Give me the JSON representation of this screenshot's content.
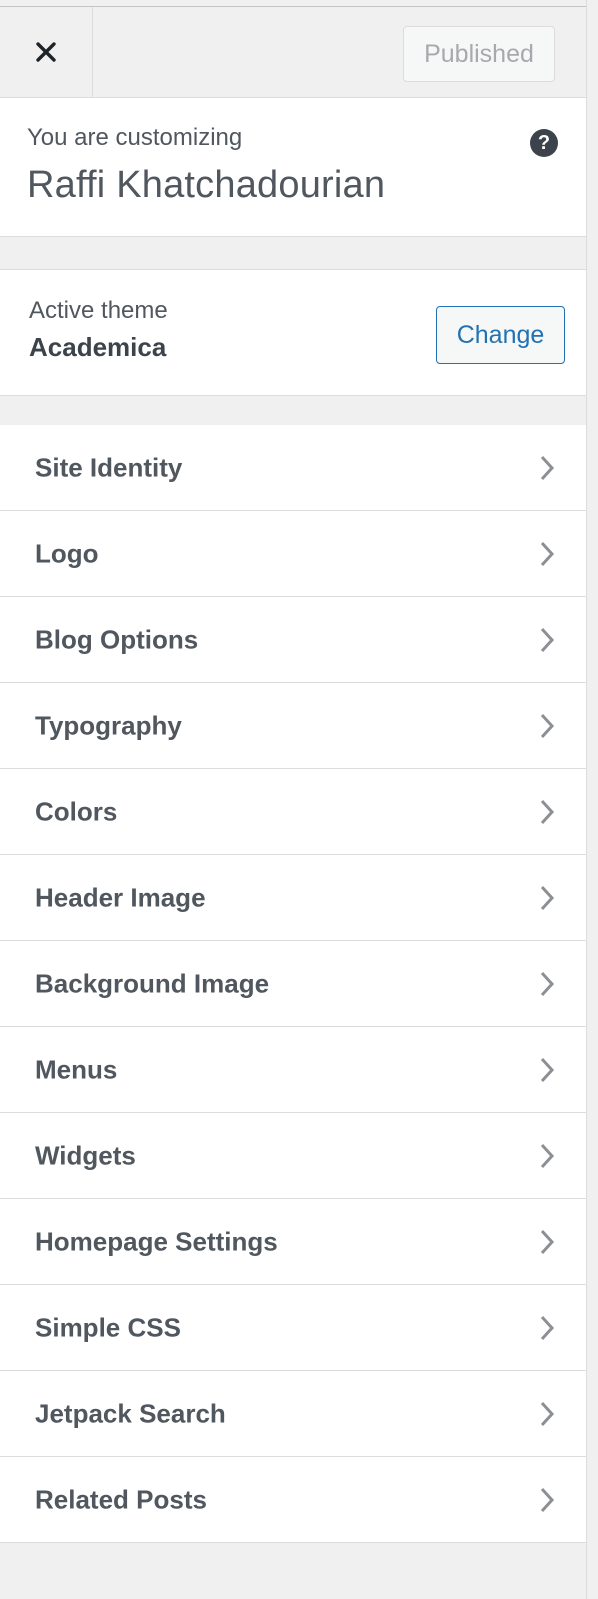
{
  "header": {
    "publish_label": "Published"
  },
  "info": {
    "label": "You are customizing",
    "site_title": "Raffi Khatchadourian"
  },
  "theme": {
    "label": "Active theme",
    "name": "Academica",
    "change_label": "Change"
  },
  "sections": [
    {
      "label": "Site Identity"
    },
    {
      "label": "Logo"
    },
    {
      "label": "Blog Options"
    },
    {
      "label": "Typography"
    },
    {
      "label": "Colors"
    },
    {
      "label": "Header Image"
    },
    {
      "label": "Background Image"
    },
    {
      "label": "Menus"
    },
    {
      "label": "Widgets"
    },
    {
      "label": "Homepage Settings"
    },
    {
      "label": "Simple CSS"
    },
    {
      "label": "Jetpack Search"
    },
    {
      "label": "Related Posts"
    }
  ],
  "icons": {
    "close": "close-icon",
    "help": "help-icon",
    "chevron": "chevron-right-icon"
  },
  "colors": {
    "accent": "#2271b1",
    "text": "#50575e",
    "muted": "#a7aaad",
    "background": "#f0f0f1"
  }
}
